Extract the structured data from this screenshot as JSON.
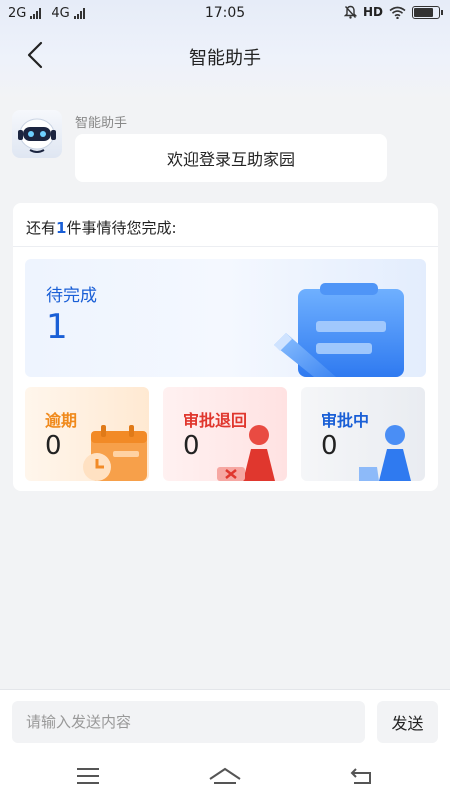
{
  "status_bar": {
    "network_1": "2G",
    "network_2": "4G",
    "time": "17:05",
    "hd": "HD",
    "battery_level": 0.85
  },
  "nav": {
    "title": "智能助手",
    "back_icon": "chevron-left-icon"
  },
  "chat": {
    "bot_name": "智能助手",
    "welcome": "欢迎登录互助家园"
  },
  "tasks": {
    "header_prefix": "还有",
    "count": "1",
    "header_suffix": "件事情待您完成:",
    "pending": {
      "label": "待完成",
      "value": "1"
    },
    "tiles": [
      {
        "label": "逾期",
        "value": "0",
        "color": "#f08a1c"
      },
      {
        "label": "审批退回",
        "value": "0",
        "color": "#e0372e"
      },
      {
        "label": "审批中",
        "value": "0",
        "color": "#1a5fd6"
      }
    ],
    "accent": "#1a5fd6"
  },
  "composer": {
    "placeholder": "请输入发送内容",
    "value": "",
    "send_label": "发送"
  },
  "system_nav": {
    "menu_icon": "menu-icon",
    "home_icon": "home-icon",
    "back_icon": "return-icon"
  }
}
